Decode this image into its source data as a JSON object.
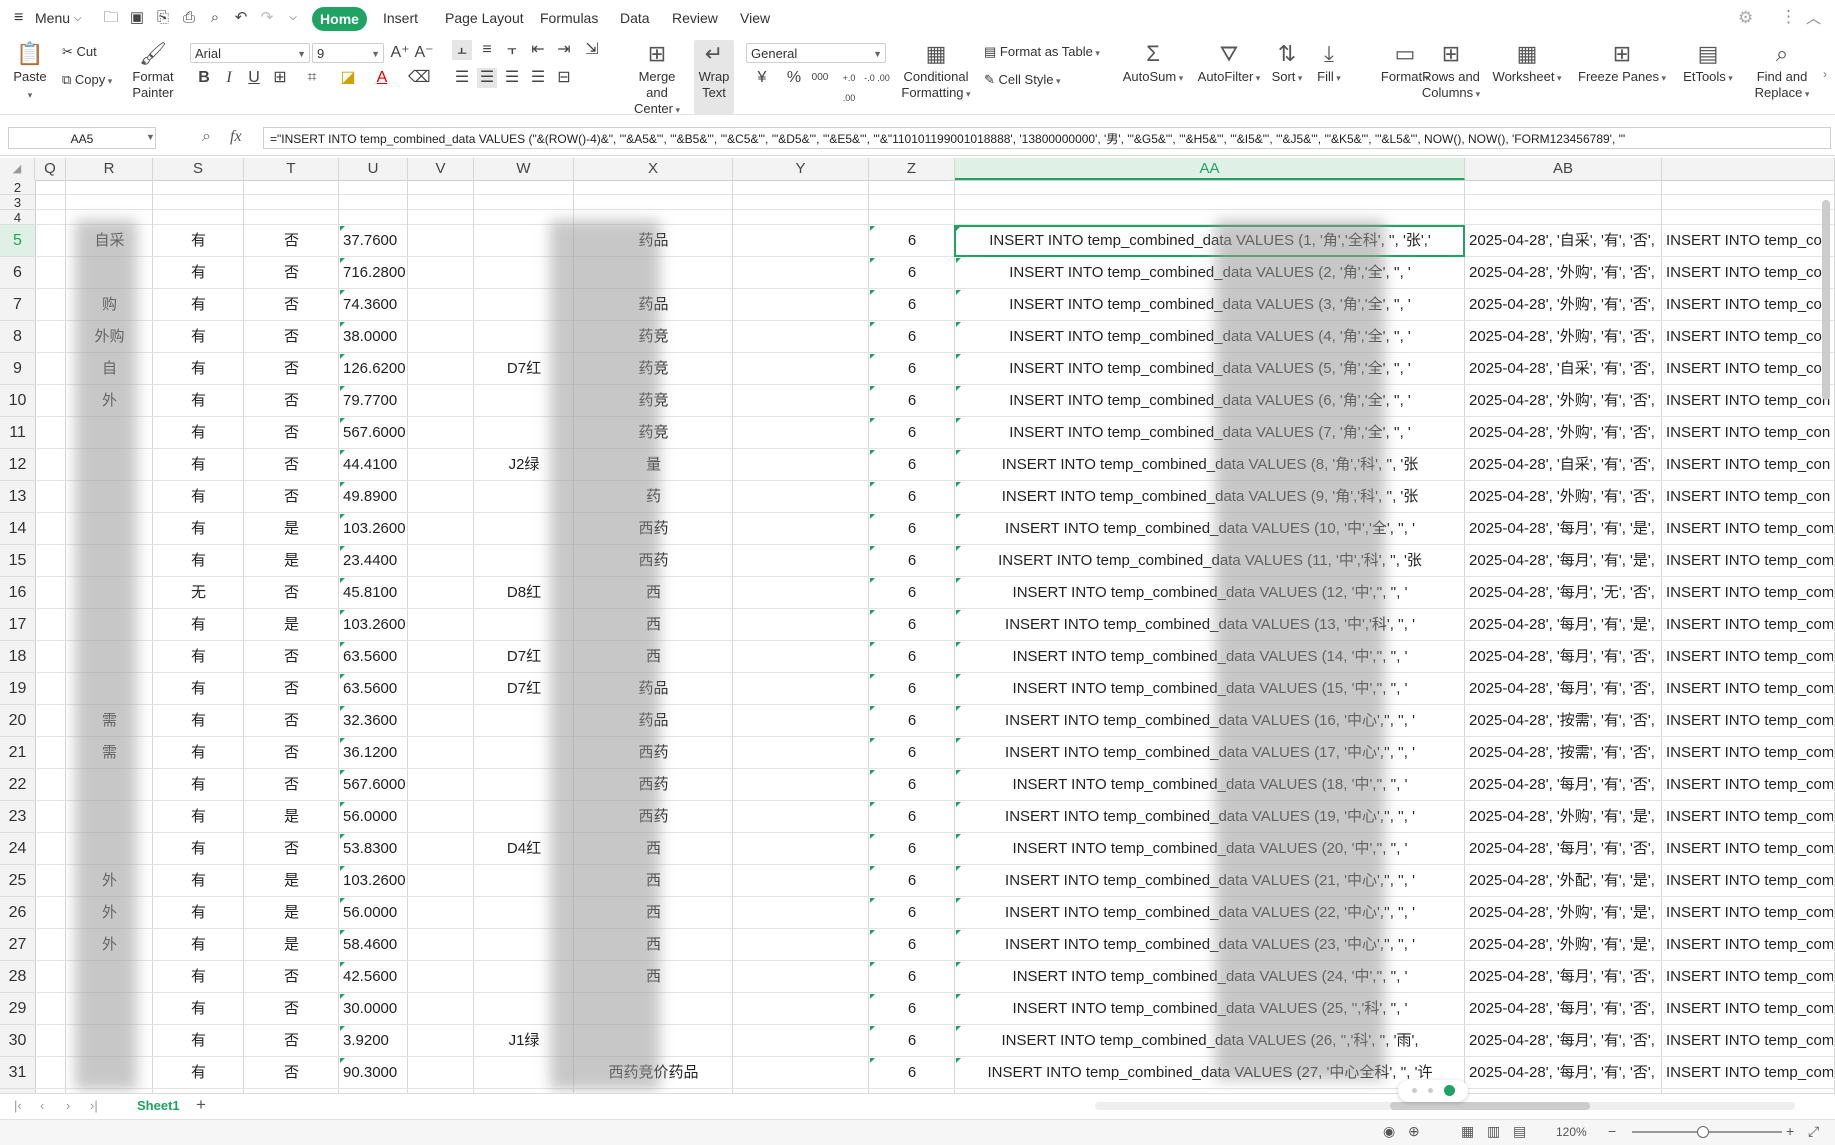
{
  "menubar": {
    "menu_label": "Menu",
    "tabs": [
      "Home",
      "Insert",
      "Page Layout",
      "Formulas",
      "Data",
      "Review",
      "View"
    ],
    "active_tab": "Home"
  },
  "ribbon": {
    "paste": "Paste",
    "cut": "Cut",
    "copy": "Copy",
    "format_painter_1": "Format",
    "format_painter_2": "Painter",
    "font_name": "Arial",
    "font_size": "9",
    "bold": "B",
    "italic": "I",
    "underline": "U",
    "merge_1": "Merge and",
    "merge_2": "Center",
    "wrap_1": "Wrap",
    "wrap_2": "Text",
    "number_format": "General",
    "currency": "¥",
    "percent": "%",
    "thousands": "000",
    "dec_inc": "+.0 .00",
    "dec_dec": "-.0 .00",
    "cond_1": "Conditional",
    "cond_2": "Formatting",
    "format_as_table": "Format as Table",
    "cell_style": "Cell Style",
    "autosum": "AutoSum",
    "autofilter": "AutoFilter",
    "sort": "Sort",
    "fill": "Fill",
    "format": "Format",
    "rows_cols_1": "Rows and",
    "rows_cols_2": "Columns",
    "worksheet": "Worksheet",
    "freeze": "Freeze Panes",
    "ettools": "EtTools",
    "find_1": "Find and",
    "find_2": "Replace"
  },
  "formula_bar": {
    "name_box": "AA5",
    "fx": "fx",
    "formula": "=\"INSERT INTO temp_combined_data VALUES (\"&(ROW()-4)&\", '\"&A5&\"', '\"&B5&\"', '\"&C5&\"', '\"&D5&\"', '\"&E5&\"', '\"&\"110101199001018888', '13800000000', '男', '\"&G5&\"', '\"&H5&\"', '\"&I5&\"', '\"&J5&\"', '\"&K5&\"', '\"&L5&\"', NOW(), NOW(), 'FORM123456789', '\""
  },
  "columns": [
    "Q",
    "R",
    "S",
    "T",
    "U",
    "V",
    "W",
    "X",
    "Y",
    "Z",
    "AA",
    "AB"
  ],
  "rows": [
    {
      "n": "5",
      "r": "自采",
      "s": "有",
      "t": "否",
      "u": "37.7600",
      "w": "",
      "x": "药品",
      "z": "6",
      "aa": "INSERT INTO temp_combined_data VALUES (1, '角','全科', '', '张','",
      "ab": "2025-04-28', '自采', '有', '否',",
      "ac": "INSERT INTO temp_con"
    },
    {
      "n": "6",
      "r": "",
      "s": "有",
      "t": "否",
      "u": "716.2800",
      "w": "",
      "x": "",
      "z": "6",
      "aa": "INSERT INTO temp_combined_data VALUES (2, '角','全', '', '",
      "ab": "2025-04-28', '外购', '有', '否',",
      "ac": "INSERT INTO temp_con"
    },
    {
      "n": "7",
      "r": "购",
      "s": "有",
      "t": "否",
      "u": "74.3600",
      "w": "",
      "x": "药品",
      "z": "6",
      "aa": "INSERT INTO temp_combined_data VALUES (3, '角','全', '', '",
      "ab": "2025-04-28', '外购', '有', '否',",
      "ac": "INSERT INTO temp_con"
    },
    {
      "n": "8",
      "r": "外购",
      "s": "有",
      "t": "否",
      "u": "38.0000",
      "w": "",
      "x": "药竞",
      "z": "6",
      "aa": "INSERT INTO temp_combined_data VALUES (4, '角','全', '', '",
      "ab": "2025-04-28', '外购', '有', '否',",
      "ac": "INSERT INTO temp_con"
    },
    {
      "n": "9",
      "r": "自",
      "s": "有",
      "t": "否",
      "u": "126.6200",
      "w": "D7红",
      "x": "药竞",
      "z": "6",
      "aa": "INSERT INTO temp_combined_data VALUES (5, '角','全', '', '",
      "ab": "2025-04-28', '自采', '有', '否',",
      "ac": "INSERT INTO temp_con"
    },
    {
      "n": "10",
      "r": "外",
      "s": "有",
      "t": "否",
      "u": "79.7700",
      "w": "",
      "x": "药竞",
      "z": "6",
      "aa": "INSERT INTO temp_combined_data VALUES (6, '角','全', '', '",
      "ab": "2025-04-28', '外购', '有', '否',",
      "ac": "INSERT INTO temp_con"
    },
    {
      "n": "11",
      "r": "",
      "s": "有",
      "t": "否",
      "u": "567.6000",
      "w": "",
      "x": "药竞",
      "z": "6",
      "aa": "INSERT INTO temp_combined_data VALUES (7, '角','全', '', '",
      "ab": "2025-04-28', '外购', '有', '否',",
      "ac": "INSERT INTO temp_con"
    },
    {
      "n": "12",
      "r": "",
      "s": "有",
      "t": "否",
      "u": "44.4100",
      "w": "J2绿",
      "x": "量",
      "z": "6",
      "aa": "INSERT INTO temp_combined_data VALUES (8, '角','科', '', '张",
      "ab": "2025-04-28', '自采', '有', '否',",
      "ac": "INSERT INTO temp_con"
    },
    {
      "n": "13",
      "r": "",
      "s": "有",
      "t": "否",
      "u": "49.8900",
      "w": "",
      "x": "药",
      "z": "6",
      "aa": "INSERT INTO temp_combined_data VALUES (9, '角','科', '', '张",
      "ab": "2025-04-28', '外购', '有', '否',",
      "ac": "INSERT INTO temp_con"
    },
    {
      "n": "14",
      "r": "",
      "s": "有",
      "t": "是",
      "u": "103.2600",
      "w": "",
      "x": "西药",
      "z": "6",
      "aa": "INSERT INTO temp_combined_data VALUES (10, '中','全', '', '",
      "ab": "2025-04-28', '每月', '有', '是',",
      "ac": "INSERT INTO temp_com"
    },
    {
      "n": "15",
      "r": "",
      "s": "有",
      "t": "是",
      "u": "23.4400",
      "w": "",
      "x": "西药",
      "z": "6",
      "aa": "INSERT INTO temp_combined_data VALUES (11, '中','科', '', '张",
      "ab": "2025-04-28', '每月', '有', '是',",
      "ac": "INSERT INTO temp_com"
    },
    {
      "n": "16",
      "r": "",
      "s": "无",
      "t": "否",
      "u": "45.8100",
      "w": "D8红",
      "x": "西",
      "z": "6",
      "aa": "INSERT INTO temp_combined_data VALUES (12, '中','', '', '",
      "ab": "2025-04-28', '每月', '无', '否',",
      "ac": "INSERT INTO temp_com"
    },
    {
      "n": "17",
      "r": "",
      "s": "有",
      "t": "是",
      "u": "103.2600",
      "w": "",
      "x": "西",
      "z": "6",
      "aa": "INSERT INTO temp_combined_data VALUES (13, '中','科', '', '",
      "ab": "2025-04-28', '每月', '有', '是',",
      "ac": "INSERT INTO temp_com"
    },
    {
      "n": "18",
      "r": "",
      "s": "有",
      "t": "否",
      "u": "63.5600",
      "w": "D7红",
      "x": "西",
      "z": "6",
      "aa": "INSERT INTO temp_combined_data VALUES (14, '中','', '', '",
      "ab": "2025-04-28', '每月', '有', '否',",
      "ac": "INSERT INTO temp_com"
    },
    {
      "n": "19",
      "r": "",
      "s": "有",
      "t": "否",
      "u": "63.5600",
      "w": "D7红",
      "x": "药品",
      "z": "6",
      "aa": "INSERT INTO temp_combined_data VALUES (15, '中','', '', '",
      "ab": "2025-04-28', '每月', '有', '否',",
      "ac": "INSERT INTO temp_com"
    },
    {
      "n": "20",
      "r": "需",
      "s": "有",
      "t": "否",
      "u": "32.3600",
      "w": "",
      "x": "药品",
      "z": "6",
      "aa": "INSERT INTO temp_combined_data VALUES (16, '中心','', '', '",
      "ab": "2025-04-28', '按需', '有', '否',",
      "ac": "INSERT INTO temp_com"
    },
    {
      "n": "21",
      "r": "需",
      "s": "有",
      "t": "否",
      "u": "36.1200",
      "w": "",
      "x": "西药",
      "z": "6",
      "aa": "INSERT INTO temp_combined_data VALUES (17, '中心','', '', '",
      "ab": "2025-04-28', '按需', '有', '否',",
      "ac": "INSERT INTO temp_com"
    },
    {
      "n": "22",
      "r": "",
      "s": "有",
      "t": "否",
      "u": "567.6000",
      "w": "",
      "x": "西药",
      "z": "6",
      "aa": "INSERT INTO temp_combined_data VALUES (18, '中','', '', '",
      "ab": "2025-04-28', '每月', '有', '否',",
      "ac": "INSERT INTO temp_com"
    },
    {
      "n": "23",
      "r": "",
      "s": "有",
      "t": "是",
      "u": "56.0000",
      "w": "",
      "x": "西药",
      "z": "6",
      "aa": "INSERT INTO temp_combined_data VALUES (19, '中心','', '', '",
      "ab": "2025-04-28', '外购', '有', '是',",
      "ac": "INSERT INTO temp_com"
    },
    {
      "n": "24",
      "r": "",
      "s": "有",
      "t": "否",
      "u": "53.8300",
      "w": "D4红",
      "x": "西",
      "z": "6",
      "aa": "INSERT INTO temp_combined_data VALUES (20, '中','', '', '",
      "ab": "2025-04-28', '每月', '有', '否',",
      "ac": "INSERT INTO temp_com"
    },
    {
      "n": "25",
      "r": "外",
      "s": "有",
      "t": "是",
      "u": "103.2600",
      "w": "",
      "x": "西",
      "z": "6",
      "aa": "INSERT INTO temp_combined_data VALUES (21, '中心','', '', '",
      "ab": "2025-04-28', '外配', '有', '是',",
      "ac": "INSERT INTO temp_com"
    },
    {
      "n": "26",
      "r": "外",
      "s": "有",
      "t": "是",
      "u": "56.0000",
      "w": "",
      "x": "西",
      "z": "6",
      "aa": "INSERT INTO temp_combined_data VALUES (22, '中心','', '', '",
      "ab": "2025-04-28', '外购', '有', '是',",
      "ac": "INSERT INTO temp_com"
    },
    {
      "n": "27",
      "r": "外",
      "s": "有",
      "t": "是",
      "u": "58.4600",
      "w": "",
      "x": "西",
      "z": "6",
      "aa": "INSERT INTO temp_combined_data VALUES (23, '中心','', '', '",
      "ab": "2025-04-28', '外购', '有', '是',",
      "ac": "INSERT INTO temp_com"
    },
    {
      "n": "28",
      "r": "",
      "s": "有",
      "t": "否",
      "u": "42.5600",
      "w": "",
      "x": "西",
      "z": "6",
      "aa": "INSERT INTO temp_combined_data VALUES (24, '中','', '', '",
      "ab": "2025-04-28', '每月', '有', '否',",
      "ac": "INSERT INTO temp_com"
    },
    {
      "n": "29",
      "r": "",
      "s": "有",
      "t": "否",
      "u": "30.0000",
      "w": "",
      "x": "",
      "z": "6",
      "aa": "INSERT INTO temp_combined_data VALUES (25, '','科', '', '",
      "ab": "2025-04-28', '每月', '有', '否',",
      "ac": "INSERT INTO temp_com"
    },
    {
      "n": "30",
      "r": "",
      "s": "有",
      "t": "否",
      "u": "3.9200",
      "w": "J1绿",
      "x": "",
      "z": "6",
      "aa": "INSERT INTO temp_combined_data VALUES (26, '','科', '', '雨',",
      "ab": "2025-04-28', '每月', '有', '否',",
      "ac": "INSERT INTO temp_com"
    },
    {
      "n": "31",
      "r": "",
      "s": "有",
      "t": "否",
      "u": "90.3000",
      "w": "",
      "x": "西药竞价药品",
      "z": "6",
      "aa": "INSERT INTO temp_combined_data VALUES (27, '中心全科', '', '许",
      "ab": "2025-04-28', '每月', '有', '否',",
      "ac": "INSERT INTO temp_com"
    }
  ],
  "sheet_tabs": [
    "Sheet1"
  ],
  "status": {
    "zoom": "120%"
  },
  "colors": {
    "accent": "#1fa363"
  }
}
